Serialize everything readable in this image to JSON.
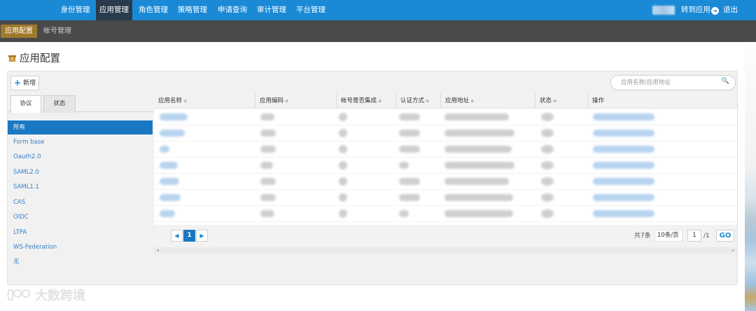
{
  "topnav": {
    "items": [
      "身份管理",
      "应用管理",
      "角色管理",
      "策略管理",
      "申请查询",
      "审计管理",
      "平台管理"
    ],
    "active": "应用管理",
    "switch_app": "转到应用",
    "logout": "退出"
  },
  "subnav": {
    "items": [
      "应用配置",
      "帐号管理"
    ],
    "active": "应用配置"
  },
  "page": {
    "title": "应用配置",
    "add_label": "新增",
    "search_placeholder": "应用名称/应用地址"
  },
  "left": {
    "tabs": [
      "协议",
      "状态"
    ],
    "active_tab": "协议",
    "filters": [
      "所有",
      "Form base",
      "Oauth2.0",
      "SAML2.0",
      "SAML1.1",
      "CAS",
      "OIDC",
      "LTPA",
      "WS-Federation",
      "无"
    ],
    "active_filter": "所有"
  },
  "table": {
    "columns": [
      "应用名称",
      "应用编码",
      "帐号是否集成",
      "认证方式",
      "应用地址",
      "状态",
      "操作"
    ],
    "row_count": 7
  },
  "pagination": {
    "prev_icon": "chevron-left-icon",
    "current_page": "1",
    "next_icon": "chevron-right-icon",
    "total_text": "共7条",
    "page_size": "10条/页",
    "page_input": "1",
    "total_pages": "/1",
    "go_label": "GO"
  },
  "watermark": {
    "text": "大数跨境"
  },
  "colors": {
    "nav_bg": "#1a8ad6",
    "subnav_bg": "#4a4a4a",
    "active_sub": "#a07a2c",
    "accent": "#1a78c2"
  }
}
